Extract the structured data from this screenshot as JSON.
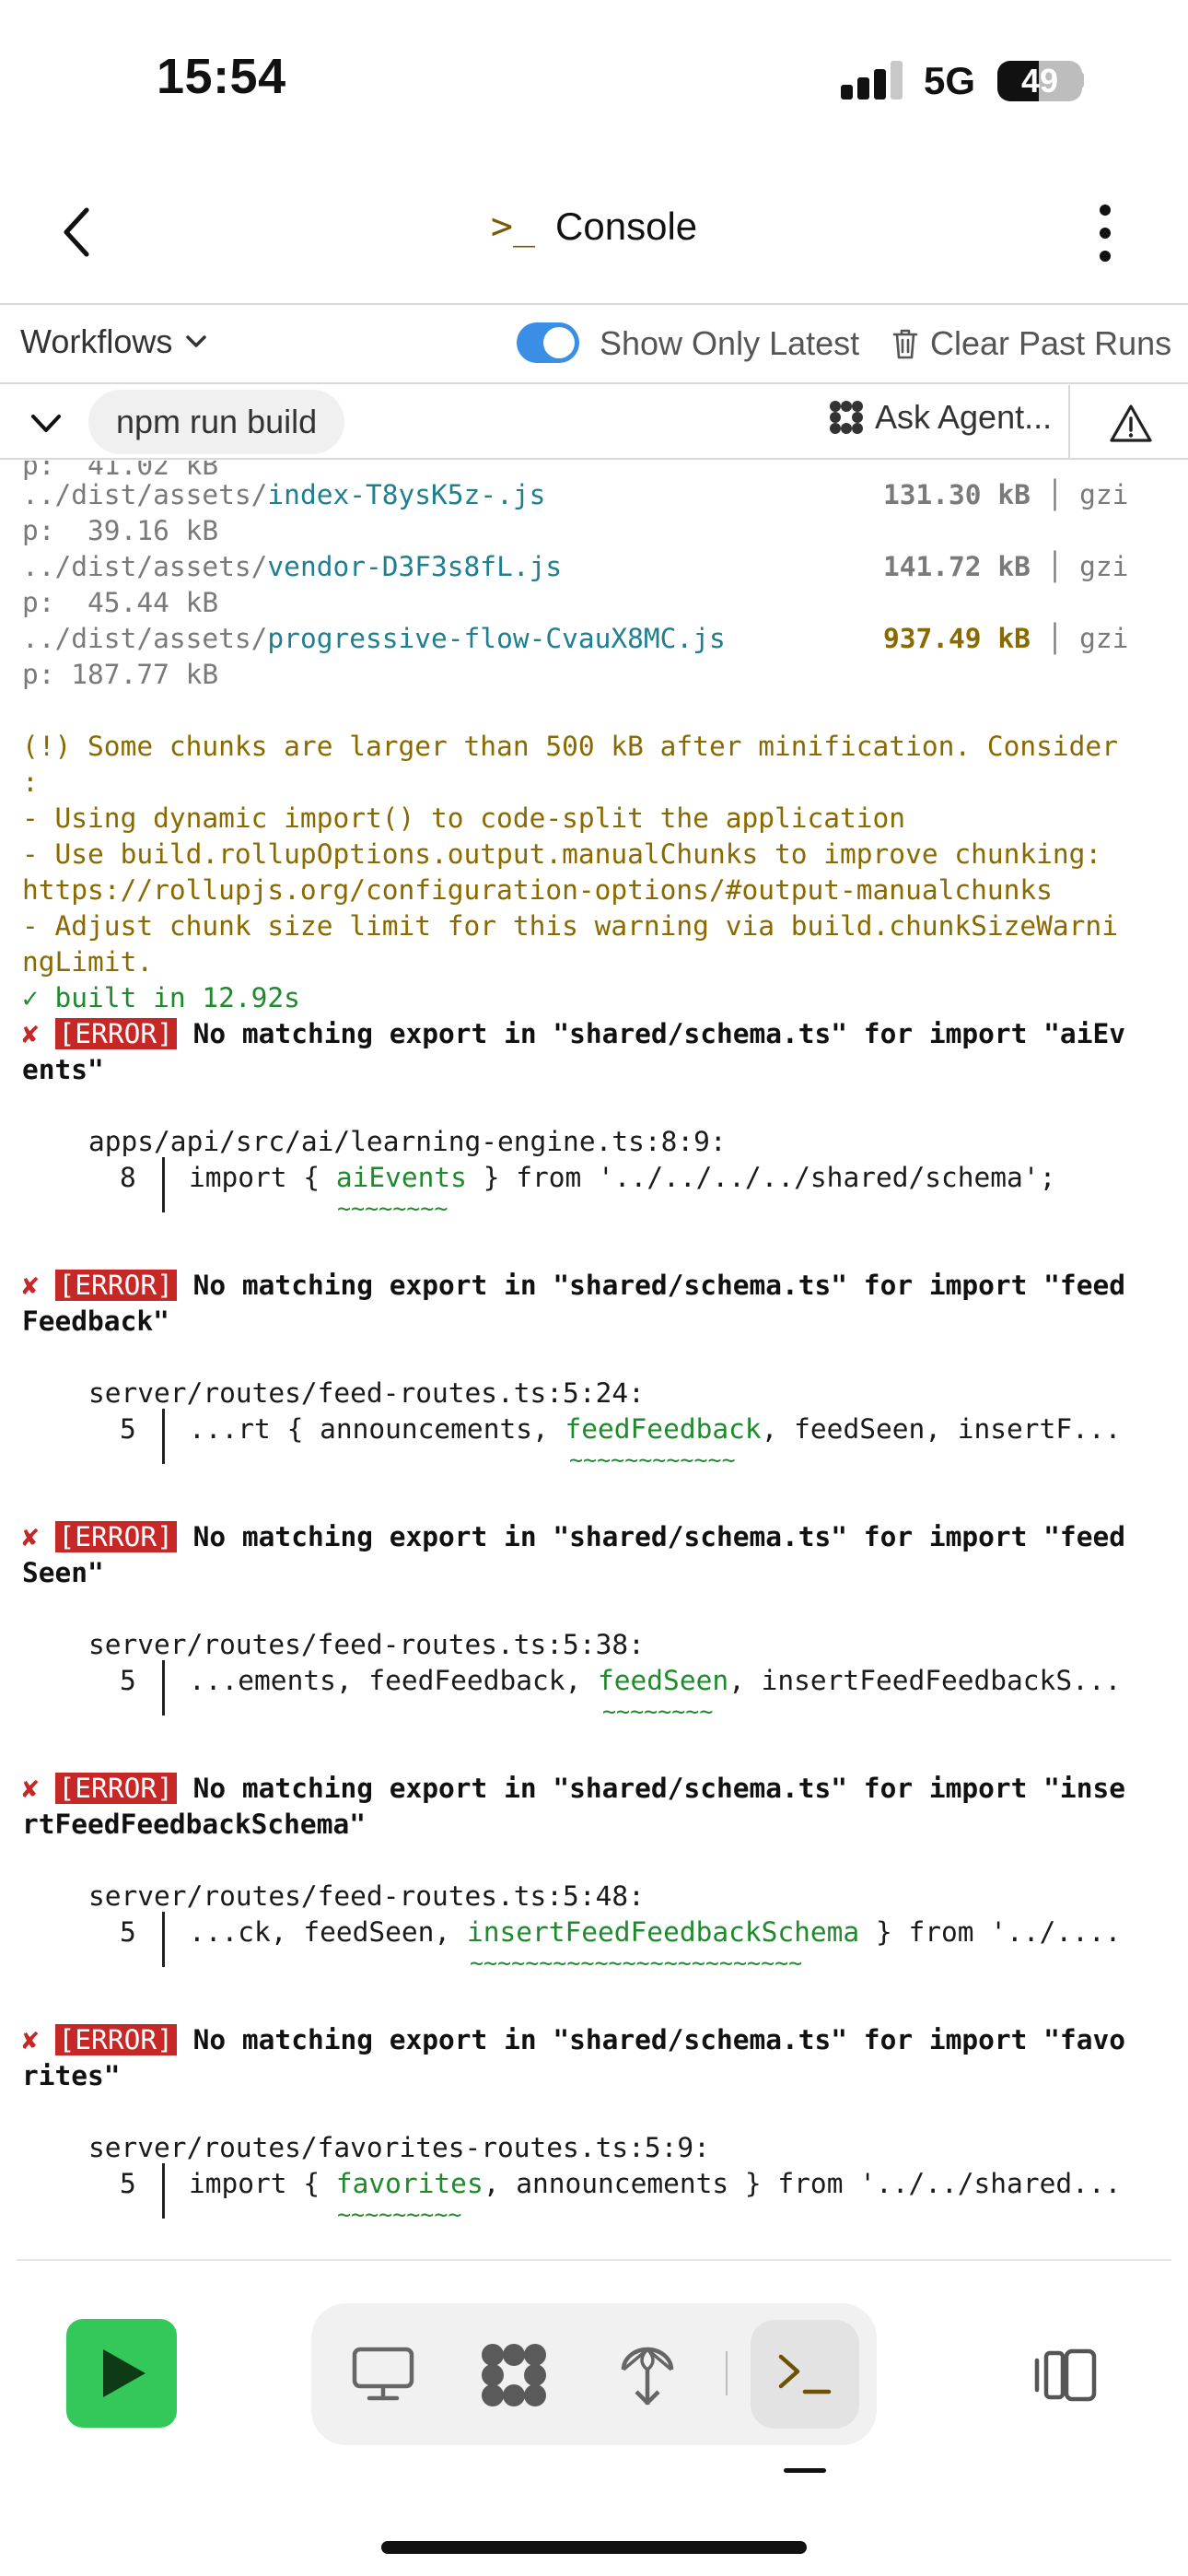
{
  "status_bar": {
    "time": "15:54",
    "network": "5G",
    "battery": "49",
    "battery_level": 0.49
  },
  "header": {
    "title": "Console",
    "title_icon": ">_"
  },
  "toolbar": {
    "workflows_label": "Workflows",
    "show_only_latest_label": "Show Only Latest",
    "show_only_latest_on": true,
    "clear_label": "Clear Past Runs"
  },
  "command_bar": {
    "command": "npm run build",
    "ask_agent_label": "Ask Agent..."
  },
  "console": {
    "top_partial": "p:  41.02 kB",
    "assets": [
      {
        "prefix": "../dist/assets/",
        "name": "index-T8ysK5z-.js",
        "size": "131.30 kB",
        "sep": "│",
        "gz_head": "gzi",
        "gz_tail": "p:  39.16 kB"
      },
      {
        "prefix": "../dist/assets/",
        "name": "vendor-D3F3s8fL.js",
        "size": "141.72 kB",
        "sep": "│",
        "gz_head": "gzi",
        "gz_tail": "p:  45.44 kB"
      },
      {
        "prefix": "../dist/assets/",
        "name": "progressive-flow-CvauX8MC.js",
        "size": "937.49 kB",
        "sep": "│",
        "gz_head": "gzi",
        "gz_tail": "p: 187.77 kB"
      }
    ],
    "warning_lines": [
      "(!) Some chunks are larger than 500 kB after minification. Consider",
      ":",
      "- Using dynamic import() to code-split the application",
      "- Use build.rollupOptions.output.manualChunks to improve chunking:",
      "https://rollupjs.org/configuration-options/#output-manualchunks",
      "- Adjust chunk size limit for this warning via build.chunkSizeWarni",
      "ngLimit."
    ],
    "built": "✓ built in 12.92s",
    "errors": [
      {
        "mark": "✘",
        "tag": "[ERROR]",
        "message_1": "No matching export in \"shared/schema.ts\" for import \"aiEv",
        "message_2": "ents\"",
        "location": "apps/api/src/ai/learning-engine.ts:8:9:",
        "line_no": "8",
        "code_pre": "import { ",
        "code_hl": "aiEvents",
        "code_post": " } from '../../../../shared/schema';",
        "squiggle": "~~~~~~~~"
      },
      {
        "mark": "✘",
        "tag": "[ERROR]",
        "message_1": "No matching export in \"shared/schema.ts\" for import \"feed",
        "message_2": "Feedback\"",
        "location": "server/routes/feed-routes.ts:5:24:",
        "line_no": "5",
        "code_pre": "...rt { announcements, ",
        "code_hl": "feedFeedback",
        "code_post": ", feedSeen, insertF...",
        "squiggle": "~~~~~~~~~~~~"
      },
      {
        "mark": "✘",
        "tag": "[ERROR]",
        "message_1": "No matching export in \"shared/schema.ts\" for import \"feed",
        "message_2": "Seen\"",
        "location": "server/routes/feed-routes.ts:5:38:",
        "line_no": "5",
        "code_pre": "...ements, feedFeedback, ",
        "code_hl": "feedSeen",
        "code_post": ", insertFeedFeedbackS...",
        "squiggle": "~~~~~~~~"
      },
      {
        "mark": "✘",
        "tag": "[ERROR]",
        "message_1": "No matching export in \"shared/schema.ts\" for import \"inse",
        "message_2": "rtFeedFeedbackSchema\"",
        "location": "server/routes/feed-routes.ts:5:48:",
        "line_no": "5",
        "code_pre": "...ck, feedSeen, ",
        "code_hl": "insertFeedFeedbackSchema",
        "code_post": " } from '../....",
        "squiggle": "~~~~~~~~~~~~~~~~~~~~~~~~"
      },
      {
        "mark": "✘",
        "tag": "[ERROR]",
        "message_1": "No matching export in \"shared/schema.ts\" for import \"favo",
        "message_2": "rites\"",
        "location": "server/routes/favorites-routes.ts:5:9:",
        "line_no": "5",
        "code_pre": "import { ",
        "code_hl": "favorites",
        "code_post": ", announcements } from '../../shared...",
        "squiggle": "~~~~~~~~~"
      }
    ]
  },
  "bottom_bar": {
    "run_icon": "play-icon",
    "dock_icons": [
      "monitor-icon",
      "agent-icon",
      "deploy-icon",
      "console-icon"
    ],
    "active": "console-icon",
    "split_icon": "split-view-icon"
  }
}
